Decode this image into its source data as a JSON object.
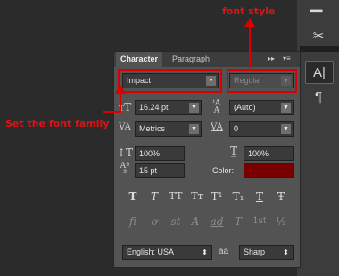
{
  "annotations": {
    "font_style": "font style",
    "font_family": "Set the font family"
  },
  "panel": {
    "tabs": [
      {
        "label": "Character"
      },
      {
        "label": "Paragraph"
      }
    ],
    "font_family": "Impact",
    "font_style": "Regular",
    "size": "16.24 pt",
    "leading": "(Auto)",
    "kerning": "Metrics",
    "tracking": "0",
    "vertical_scale": "100%",
    "horizontal_scale": "100%",
    "baseline_shift": "15 pt",
    "color_label": "Color:",
    "color_value": "#7a0000",
    "language": "English: USA",
    "antialias_icon_text": "aa",
    "antialias": "Sharp"
  },
  "style_buttons": [
    "T",
    "T",
    "TT",
    "Tт",
    "T¹",
    "T₁",
    "T",
    "Ŧ"
  ],
  "opentype_buttons": [
    "fi",
    "ơ",
    "st",
    "A",
    "ad",
    "T",
    "1st",
    "½"
  ],
  "colors": {
    "accent_red": "#e01212",
    "swatch": "#7a0000"
  }
}
